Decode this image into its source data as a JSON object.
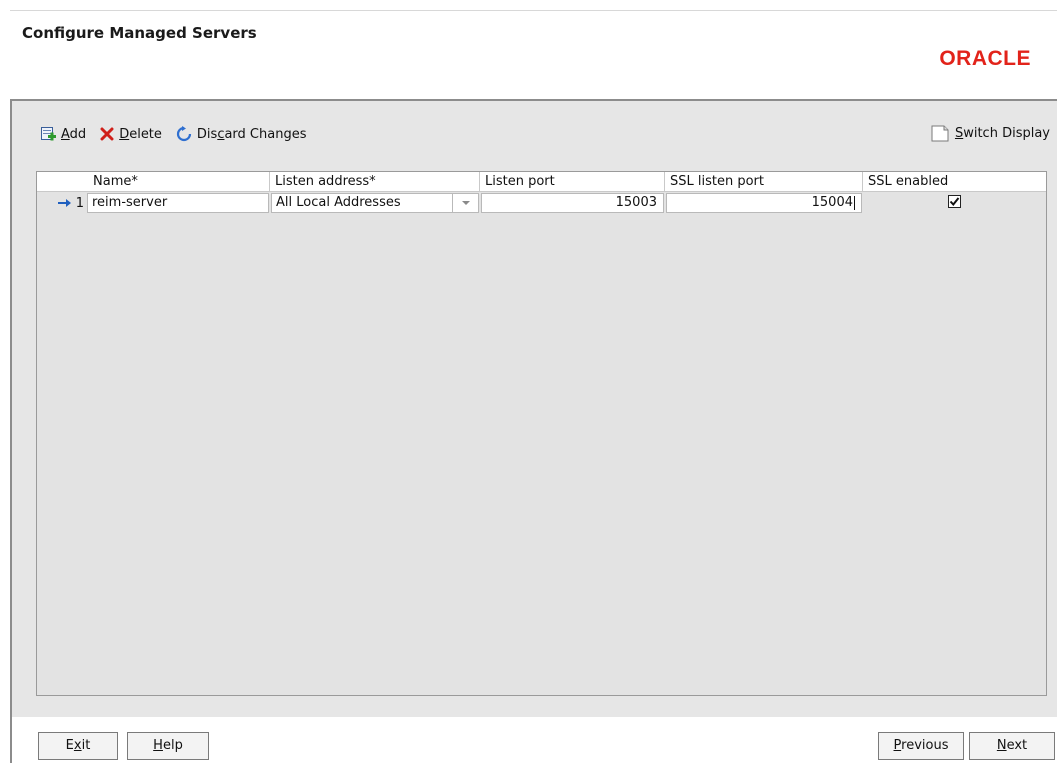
{
  "header": {
    "title": "Configure Managed Servers",
    "logo": "ORACLE"
  },
  "toolbar": {
    "add_mnemonic": "A",
    "add_rest": "dd",
    "delete_mnemonic": "D",
    "delete_rest": "elete",
    "discard_pre": "Dis",
    "discard_mnemonic": "c",
    "discard_post": "ard Changes",
    "switch_mnemonic": "S",
    "switch_rest": "witch Display"
  },
  "table": {
    "columns": [
      "Name*",
      "Listen address*",
      "Listen port",
      "SSL listen port",
      "SSL enabled"
    ],
    "rows": [
      {
        "number": "1",
        "name": "reim-server",
        "listen_address": "All Local Addresses",
        "listen_port": "15003",
        "ssl_listen_port": "15004",
        "ssl_enabled": true
      }
    ]
  },
  "footer": {
    "exit_pre": "E",
    "exit_mnemonic": "x",
    "exit_post": "it",
    "help_mnemonic": "H",
    "help_rest": "elp",
    "previous_mnemonic": "P",
    "previous_rest": "revious",
    "next_mnemonic": "N",
    "next_rest": "ext"
  },
  "colors": {
    "oracle_red": "#e2231a",
    "panel_bg": "#e6e6e6",
    "row_arrow": "#1f5fbf"
  },
  "icons": [
    "add-icon",
    "delete-icon",
    "discard-icon",
    "switch-display-icon",
    "current-row-arrow-icon",
    "dropdown-arrow-icon",
    "checkbox-checked-icon"
  ]
}
